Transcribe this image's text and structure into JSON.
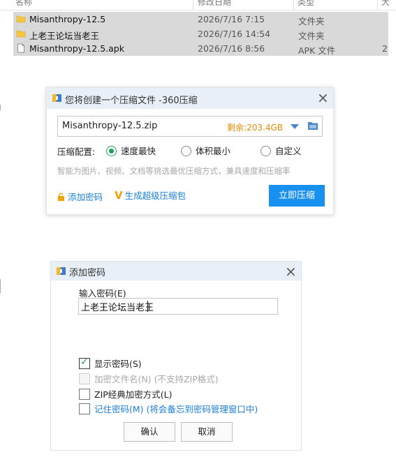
{
  "explorer": {
    "columns": [
      "名称",
      "修改日期",
      "类型",
      "大"
    ],
    "files": [
      {
        "name": "Misanthropy-12.5",
        "date": "2026/7/16 7:15",
        "type": "文件夹",
        "size": "",
        "icon": "folder-icon"
      },
      {
        "name": "上老王论坛当老王",
        "date": "2026/7/16 14:54",
        "type": "文件夹",
        "size": "",
        "icon": "folder-icon"
      },
      {
        "name": "Misanthropy-12.5.apk",
        "date": "2026/7/16 8:56",
        "type": "APK 文件",
        "size": "2",
        "icon": "file-icon"
      }
    ]
  },
  "compress_dialog": {
    "title": "您将创建一个压缩文件 -360压缩",
    "filename": "Misanthropy-12.5.zip",
    "free_space": "剩余:203.4GB",
    "config_label": "压缩配置:",
    "options": [
      {
        "label": "速度最快",
        "checked": true
      },
      {
        "label": "体积最小",
        "checked": false
      },
      {
        "label": "自定义",
        "checked": false
      }
    ],
    "hint": "智能为图片、视频、文档等挑选最优压缩方式，兼具速度和压缩率",
    "add_password_link": "添加密码",
    "super_compress_link": "生成超级压缩包",
    "compress_button": "立即压缩",
    "accent_color": "#1890f0",
    "space_color": "#e58a00"
  },
  "password_dialog": {
    "title": "添加密码",
    "input_label": "输入密码(E)",
    "password_value": "上老王论坛当老王",
    "checkboxes": [
      {
        "label": "显示密码(S)",
        "checked": true,
        "disabled": false
      },
      {
        "label": "加密文件名(N) (不支持ZIP格式)",
        "checked": false,
        "disabled": true
      },
      {
        "label": "ZIP经典加密方式(L)",
        "checked": false,
        "disabled": false
      },
      {
        "label": "记住密码(M) (将会备忘到密码管理窗口中)",
        "checked": false,
        "disabled": false
      }
    ],
    "ok_button": "确认",
    "cancel_button": "取消"
  }
}
